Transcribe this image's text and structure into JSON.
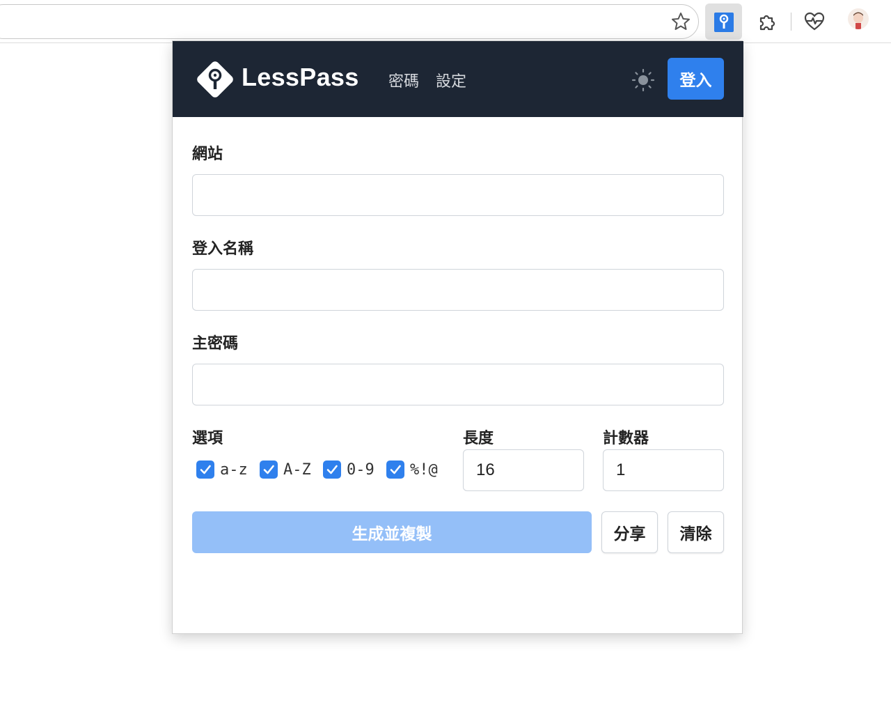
{
  "browser": {
    "extension_icons": [
      "lesspass-key-icon",
      "puzzle-extensions-icon",
      "heart-pulse-icon"
    ],
    "bookmark_icon": "star-icon"
  },
  "popup": {
    "brand": "LessPass",
    "nav": {
      "password": "密碼",
      "settings": "設定"
    },
    "login_label": "登入",
    "accent_color": "#2f80ed",
    "navbar_color": "#1d2634",
    "form": {
      "site_label": "網站",
      "site_value": "",
      "login_label": "登入名稱",
      "login_value": "",
      "master_label": "主密碼",
      "master_value": "",
      "options_label": "選項",
      "options": [
        {
          "label": "a-z",
          "checked": true
        },
        {
          "label": "A-Z",
          "checked": true
        },
        {
          "label": "0-9",
          "checked": true
        },
        {
          "label": "%!@",
          "checked": true
        }
      ],
      "length_label": "長度",
      "length_value": "16",
      "counter_label": "計數器",
      "counter_value": "1"
    },
    "buttons": {
      "generate": "生成並複製",
      "share": "分享",
      "clear": "清除"
    }
  }
}
